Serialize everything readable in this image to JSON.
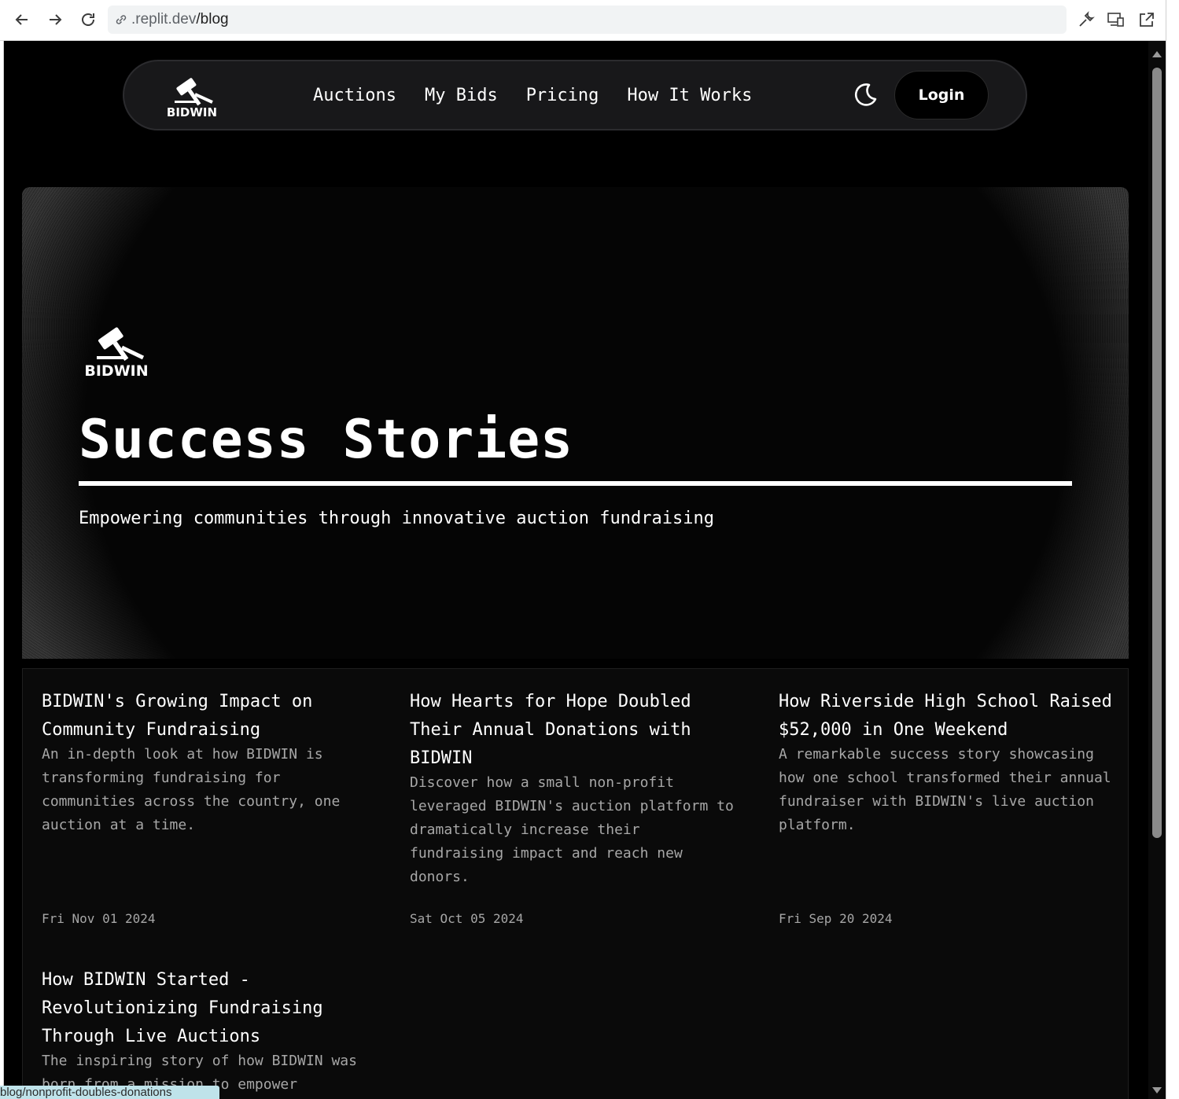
{
  "browser": {
    "url_host": ".replit.dev",
    "url_path": "/blog"
  },
  "navbar": {
    "logo_text": "BIDWIN",
    "links": [
      "Auctions",
      "My Bids",
      "Pricing",
      "How It Works"
    ],
    "login_label": "Login"
  },
  "hero": {
    "logo_text": "BIDWIN",
    "title": "Success Stories",
    "subtitle": "Empowering communities through innovative auction fundraising"
  },
  "posts": [
    {
      "title": "BIDWIN's Growing Impact on Community Fundraising",
      "excerpt": "An in-depth look at how BIDWIN is transforming fundraising for communities across the country, one auction at a time.",
      "date": "Fri Nov 01 2024"
    },
    {
      "title": "How Hearts for Hope Doubled Their Annual Donations with BIDWIN",
      "excerpt": "Discover how a small non-profit leveraged BIDWIN's auction platform to dramatically increase their fundraising impact and reach new donors.",
      "date": "Sat Oct 05 2024"
    },
    {
      "title": "How Riverside High School Raised $52,000 in One Weekend",
      "excerpt": "A remarkable success story showcasing how one school transformed their annual fundraiser with BIDWIN's live auction platform.",
      "date": "Fri Sep 20 2024"
    },
    {
      "title": "How BIDWIN Started - Revolutionizing Fundraising Through Live Auctions",
      "excerpt": "The inspiring story of how BIDWIN was born from a mission to empower",
      "date": ""
    }
  ],
  "status_link": "blog/nonprofit-doubles-donations",
  "colors": {
    "page_bg": "#000000",
    "navbar_bg": "#18181a",
    "text": "#ffffff",
    "muted_text": "#a7a7a7"
  }
}
